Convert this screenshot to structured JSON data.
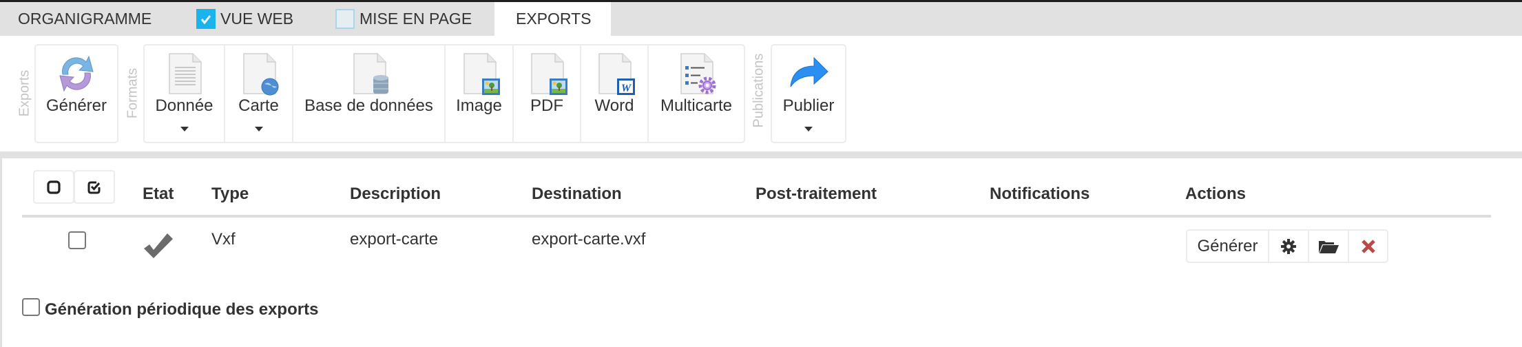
{
  "tabs": [
    {
      "label": "ORGANIGRAMME",
      "checkbox": null,
      "active": false
    },
    {
      "label": "VUE WEB",
      "checkbox": true,
      "active": false
    },
    {
      "label": "MISE EN PAGE",
      "checkbox": false,
      "active": false
    },
    {
      "label": "EXPORTS",
      "checkbox": null,
      "active": true
    }
  ],
  "toolbar": {
    "groups": {
      "exports": {
        "label": "Exports",
        "items": [
          {
            "label": "Générer",
            "icon": "refresh-icon",
            "dropdown": false
          }
        ]
      },
      "formats": {
        "label": "Formats",
        "items": [
          {
            "label": "Donnée",
            "icon": "data-file-icon",
            "dropdown": true
          },
          {
            "label": "Carte",
            "icon": "map-file-icon",
            "dropdown": true
          },
          {
            "label": "Base de données",
            "icon": "database-file-icon",
            "dropdown": false
          },
          {
            "label": "Image",
            "icon": "image-file-icon",
            "dropdown": false
          },
          {
            "label": "PDF",
            "icon": "pdf-file-icon",
            "dropdown": false
          },
          {
            "label": "Word",
            "icon": "word-file-icon",
            "dropdown": false
          },
          {
            "label": "Multicarte",
            "icon": "multimap-file-icon",
            "dropdown": false
          }
        ]
      },
      "publications": {
        "label": "Publications",
        "items": [
          {
            "label": "Publier",
            "icon": "share-arrow-icon",
            "dropdown": true
          }
        ]
      }
    }
  },
  "table": {
    "select_none_icon": "square-icon",
    "select_all_icon": "check-square-icon",
    "columns": [
      "Etat",
      "Type",
      "Description",
      "Destination",
      "Post-traitement",
      "Notifications",
      "Actions"
    ],
    "rows": [
      {
        "selected": false,
        "state": "ok",
        "type": "Vxf",
        "description": "export-carte",
        "destination": "export-carte.vxf",
        "post_processing": "",
        "notifications": "",
        "actions": {
          "generate_label": "Générer",
          "settings_icon": "gear-icon",
          "open_icon": "folder-open-icon",
          "delete_icon": "close-icon"
        }
      }
    ]
  },
  "periodic": {
    "checked": false,
    "label": "Génération périodique des exports"
  },
  "colors": {
    "accent": "#1bb3ec",
    "delete": "#b94a48",
    "tabbar": "#e1e1e1",
    "state_check": "#6b6b6b"
  }
}
